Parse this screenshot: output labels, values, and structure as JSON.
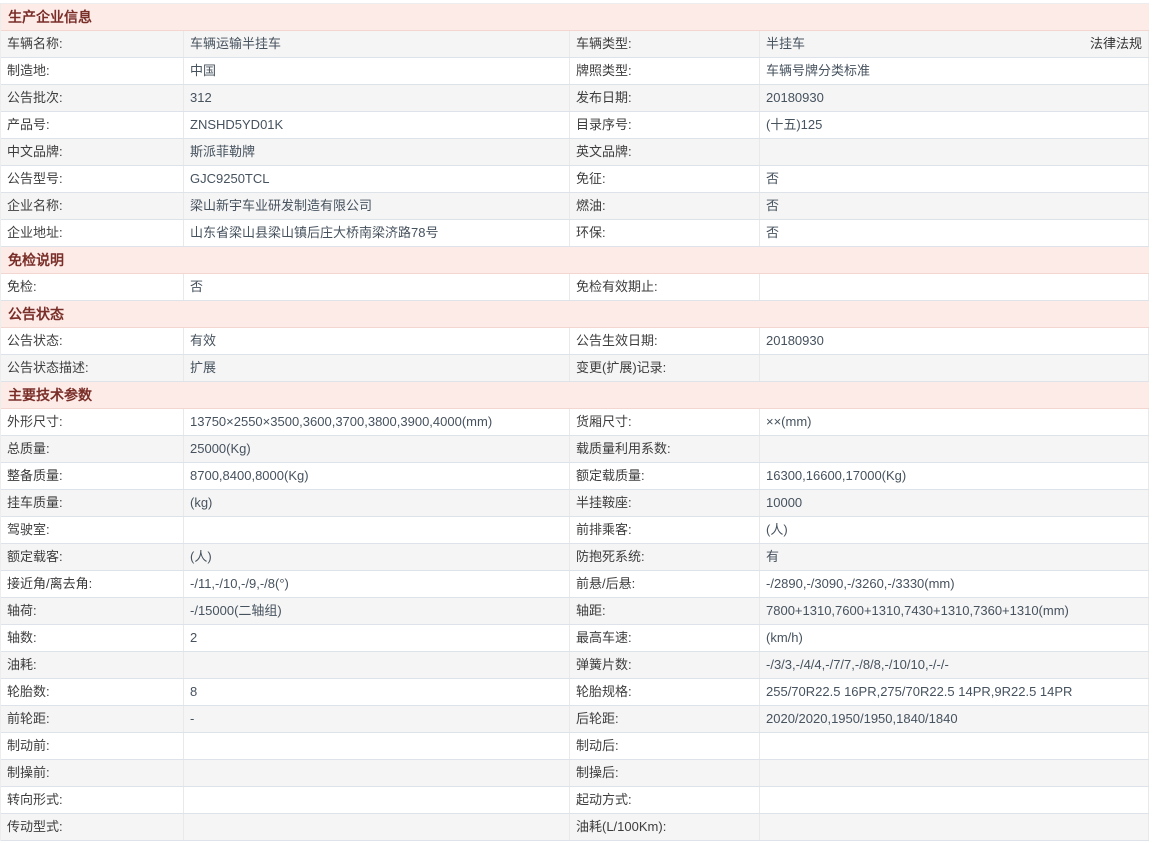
{
  "law_link_label": "法律法规",
  "colors": {
    "section_header_bg": "#fdebe8",
    "section_header_text": "#7a2e28",
    "shaded_row_bg": "#f5f5f5",
    "row_border": "#dde3e9"
  },
  "sections": [
    {
      "title": "生产企业信息",
      "rows": [
        {
          "l1": "车辆名称:",
          "v1": "车辆运输半挂车",
          "l2": "车辆类型:",
          "v2": "半挂车",
          "v2_link": "法律法规"
        },
        {
          "l1": "制造地:",
          "v1": "中国",
          "l2": "牌照类型:",
          "v2": "车辆号牌分类标准"
        },
        {
          "l1": "公告批次:",
          "v1": "312",
          "l2": "发布日期:",
          "v2": "20180930"
        },
        {
          "l1": "产品号:",
          "v1": "ZNSHD5YD01K",
          "l2": "目录序号:",
          "v2": "(十五)125"
        },
        {
          "l1": "中文品牌:",
          "v1": "斯派菲勒牌",
          "l2": "英文品牌:",
          "v2": ""
        },
        {
          "l1": "公告型号:",
          "v1": "GJC9250TCL",
          "l2": "免征:",
          "v2": "否"
        },
        {
          "l1": "企业名称:",
          "v1": "梁山新宇车业研发制造有限公司",
          "l2": "燃油:",
          "v2": "否"
        },
        {
          "l1": "企业地址:",
          "v1": "山东省梁山县梁山镇后庄大桥南梁济路78号",
          "l2": "环保:",
          "v2": "否"
        }
      ]
    },
    {
      "title": "免检说明",
      "rows": [
        {
          "l1": "免检:",
          "v1": "否",
          "l2": "免检有效期止:",
          "v2": ""
        }
      ]
    },
    {
      "title": "公告状态",
      "rows": [
        {
          "l1": "公告状态:",
          "v1": "有效",
          "l2": "公告生效日期:",
          "v2": "20180930"
        },
        {
          "l1": "公告状态描述:",
          "v1": "扩展",
          "l2": "变更(扩展)记录:",
          "v2": ""
        }
      ]
    },
    {
      "title": "主要技术参数",
      "rows": [
        {
          "l1": "外形尺寸:",
          "v1": "13750×2550×3500,3600,3700,3800,3900,4000(mm)",
          "l2": "货厢尺寸:",
          "v2": "××(mm)"
        },
        {
          "l1": "总质量:",
          "v1": "25000(Kg)",
          "l2": "载质量利用系数:",
          "v2": ""
        },
        {
          "l1": "整备质量:",
          "v1": "8700,8400,8000(Kg)",
          "l2": "额定载质量:",
          "v2": "16300,16600,17000(Kg)"
        },
        {
          "l1": "挂车质量:",
          "v1": "(kg)",
          "l2": "半挂鞍座:",
          "v2": "10000"
        },
        {
          "l1": "驾驶室:",
          "v1": "",
          "l2": "前排乘客:",
          "v2": "(人)"
        },
        {
          "l1": "额定载客:",
          "v1": "(人)",
          "l2": "防抱死系统:",
          "v2": "有"
        },
        {
          "l1": "接近角/离去角:",
          "v1": "-/11,-/10,-/9,-/8(°)",
          "l2": "前悬/后悬:",
          "v2": "-/2890,-/3090,-/3260,-/3330(mm)"
        },
        {
          "l1": "轴荷:",
          "v1": "-/15000(二轴组)",
          "l2": "轴距:",
          "v2": "7800+1310,7600+1310,7430+1310,7360+1310(mm)"
        },
        {
          "l1": "轴数:",
          "v1": "2",
          "l2": "最高车速:",
          "v2": "(km/h)"
        },
        {
          "l1": "油耗:",
          "v1": "",
          "l2": "弹簧片数:",
          "v2": "-/3/3,-/4/4,-/7/7,-/8/8,-/10/10,-/-/-"
        },
        {
          "l1": "轮胎数:",
          "v1": "8",
          "l2": "轮胎规格:",
          "v2": "255/70R22.5 16PR,275/70R22.5 14PR,9R22.5 14PR"
        },
        {
          "l1": "前轮距:",
          "v1": "-",
          "l2": "后轮距:",
          "v2": "2020/2020,1950/1950,1840/1840"
        },
        {
          "l1": "制动前:",
          "v1": "",
          "l2": "制动后:",
          "v2": ""
        },
        {
          "l1": "制操前:",
          "v1": "",
          "l2": "制操后:",
          "v2": ""
        },
        {
          "l1": "转向形式:",
          "v1": "",
          "l2": "起动方式:",
          "v2": ""
        },
        {
          "l1": "传动型式:",
          "v1": "",
          "l2": "油耗(L/100Km):",
          "v2": ""
        }
      ]
    }
  ]
}
